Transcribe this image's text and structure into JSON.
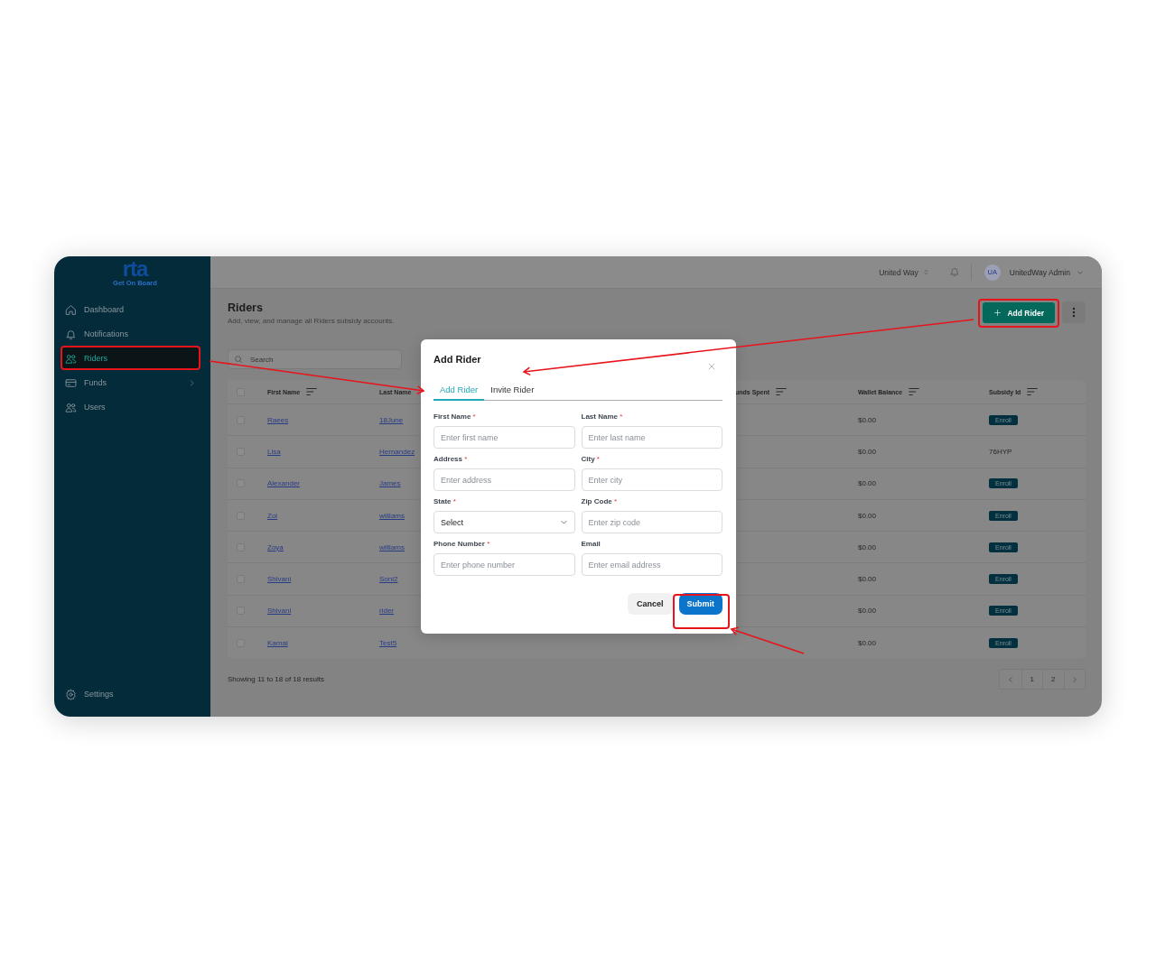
{
  "logo": {
    "name": "rta",
    "tagline": "Get On Board"
  },
  "sidebar": {
    "items": [
      {
        "label": "Dashboard",
        "selected": false,
        "has_submenu": false
      },
      {
        "label": "Notifications",
        "selected": false,
        "has_submenu": false
      },
      {
        "label": "Riders",
        "selected": true,
        "has_submenu": false
      },
      {
        "label": "Funds",
        "selected": false,
        "has_submenu": true
      },
      {
        "label": "Users",
        "selected": false,
        "has_submenu": false
      }
    ],
    "footer": {
      "label": "Settings"
    }
  },
  "topbar": {
    "organization": "United Way",
    "user": {
      "initials": "UA",
      "name": "UnitedWay Admin"
    }
  },
  "page": {
    "title": "Riders",
    "subtitle": "Add, view, and manage all Riders subsidy accounts.",
    "add_button": "Add Rider"
  },
  "search": {
    "placeholder": "Search"
  },
  "table": {
    "select_all": {
      "checked": false
    },
    "columns": [
      {
        "label": "First Name",
        "sortable": true
      },
      {
        "label": "Last Name",
        "sortable": false
      },
      {
        "label": "unds Spent",
        "sortable": true
      },
      {
        "label": "Wallet Balance",
        "sortable": true
      },
      {
        "label": "Subsidy Id",
        "sortable": true
      }
    ],
    "rows": [
      {
        "checked": false,
        "first_name": "Raees",
        "last_name": "18June",
        "wallet_balance": "$0.00",
        "subsidy": {
          "kind": "button",
          "text": "Enroll"
        }
      },
      {
        "checked": false,
        "first_name": "Lisa",
        "last_name": "Hernandez",
        "wallet_balance": "$0.00",
        "subsidy": {
          "kind": "text",
          "text": "76HYP"
        }
      },
      {
        "checked": false,
        "first_name": "Alexander",
        "last_name": "James",
        "wallet_balance": "$0.00",
        "subsidy": {
          "kind": "button",
          "text": "Enroll"
        }
      },
      {
        "checked": false,
        "first_name": "Zoi",
        "last_name": "williams",
        "wallet_balance": "$0.00",
        "subsidy": {
          "kind": "button",
          "text": "Enroll"
        }
      },
      {
        "checked": false,
        "first_name": "Zoya",
        "last_name": "williams",
        "wallet_balance": "$0.00",
        "subsidy": {
          "kind": "button",
          "text": "Enroll"
        }
      },
      {
        "checked": false,
        "first_name": "Shivani",
        "last_name": "Soni2",
        "wallet_balance": "$0.00",
        "subsidy": {
          "kind": "button",
          "text": "Enroll"
        }
      },
      {
        "checked": false,
        "first_name": "Shivani",
        "last_name": "rider",
        "wallet_balance": "$0.00",
        "subsidy": {
          "kind": "button",
          "text": "Enroll"
        }
      },
      {
        "checked": false,
        "first_name": "Kamal",
        "last_name": "Test5",
        "wallet_balance": "$0.00",
        "subsidy": {
          "kind": "button",
          "text": "Enroll"
        }
      }
    ]
  },
  "pagination": {
    "summary": "Showing 11 to 18 of 18 results",
    "pages": [
      "1",
      "2"
    ]
  },
  "modal": {
    "title": "Add Rider",
    "tabs": [
      {
        "label": "Add Rider",
        "selected": true
      },
      {
        "label": "Invite Rider",
        "selected": false
      }
    ],
    "fields": [
      {
        "kind": "input",
        "label": "First Name",
        "required_mark": "*",
        "placeholder": "Enter first name"
      },
      {
        "kind": "input",
        "label": "Last Name",
        "required_mark": "*",
        "placeholder": "Enter last name"
      },
      {
        "kind": "input",
        "label": "Address",
        "required_mark": "*",
        "placeholder": "Enter address"
      },
      {
        "kind": "input",
        "label": "City",
        "required_mark": "*",
        "placeholder": "Enter city"
      },
      {
        "kind": "select",
        "label": "State",
        "required_mark": "*",
        "value": "Select"
      },
      {
        "kind": "input",
        "label": "Zip Code",
        "required_mark": "*",
        "placeholder": "Enter zip code"
      },
      {
        "kind": "input",
        "label": "Phone Number",
        "required_mark": "*",
        "placeholder": "Enter phone number"
      },
      {
        "kind": "input",
        "label": "Email",
        "placeholder": "Enter email address"
      }
    ],
    "cancel": "Cancel",
    "submit": "Submit"
  }
}
